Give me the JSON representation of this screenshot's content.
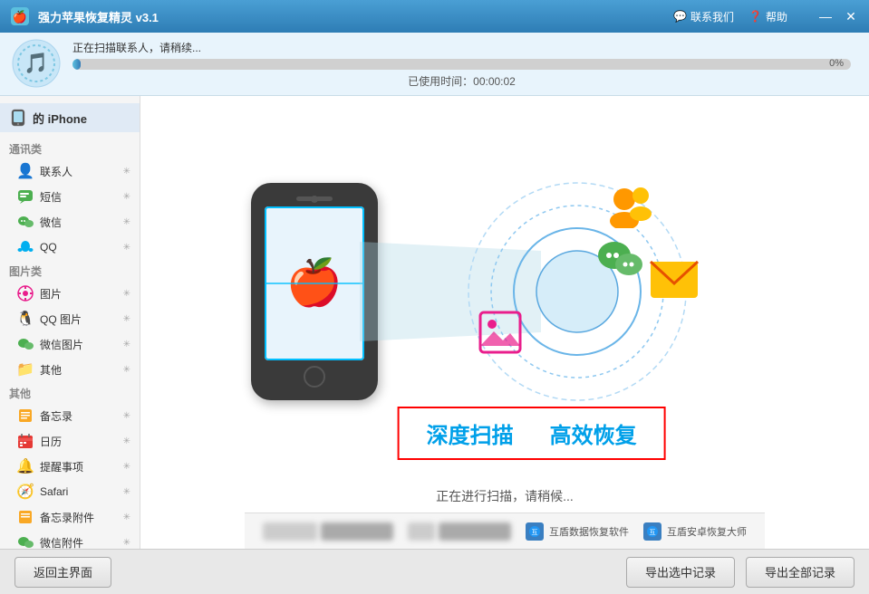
{
  "titleBar": {
    "title": "强力苹果恢复精灵 v3.1",
    "contactUs": "联系我们",
    "help": "帮助",
    "minimizeBtn": "—",
    "closeBtn": "✕"
  },
  "header": {
    "scanningLabel": "正在扫描联系人，请稍续...",
    "progressPercent": "0%",
    "timeLabel": "已使用时间：00:00:02"
  },
  "sidebar": {
    "deviceName": "的 iPhone",
    "categories": [
      {
        "label": "通讯类",
        "items": [
          {
            "name": "sidebar-item-contacts",
            "icon": "👤",
            "label": "联系人",
            "sparkle": "✳"
          },
          {
            "name": "sidebar-item-sms",
            "icon": "💬",
            "label": "短信",
            "sparkle": "✳"
          },
          {
            "name": "sidebar-item-wechat",
            "icon": "💚",
            "label": "微信",
            "sparkle": "✳"
          },
          {
            "name": "sidebar-item-qq",
            "icon": "🐧",
            "label": "QQ",
            "sparkle": "✳"
          }
        ]
      },
      {
        "label": "图片类",
        "items": [
          {
            "name": "sidebar-item-photos",
            "icon": "🌸",
            "label": "图片",
            "sparkle": "✳"
          },
          {
            "name": "sidebar-item-qq-photos",
            "icon": "🐧",
            "label": "QQ 图片",
            "sparkle": "✳"
          },
          {
            "name": "sidebar-item-wechat-photos",
            "icon": "💚",
            "label": "微信图片",
            "sparkle": "✳"
          },
          {
            "name": "sidebar-item-other",
            "icon": "📁",
            "label": "其他",
            "sparkle": "✳"
          }
        ]
      },
      {
        "label": "其他",
        "items": [
          {
            "name": "sidebar-item-notes",
            "icon": "📒",
            "label": "备忘录",
            "sparkle": "✳"
          },
          {
            "name": "sidebar-item-calendar",
            "icon": "📅",
            "label": "日历",
            "sparkle": "✳"
          },
          {
            "name": "sidebar-item-reminders",
            "icon": "🔔",
            "label": "提醒事项",
            "sparkle": "✳"
          },
          {
            "name": "sidebar-item-safari",
            "icon": "🧭",
            "label": "Safari",
            "sparkle": "✳"
          },
          {
            "name": "sidebar-item-note-attachments",
            "icon": "📒",
            "label": "备忘录附件",
            "sparkle": "✳"
          },
          {
            "name": "sidebar-item-wechat-files",
            "icon": "💚",
            "label": "微信附件",
            "sparkle": "✳"
          }
        ]
      }
    ]
  },
  "content": {
    "deepScanLabel": "深度扫描",
    "efficientRestoreLabel": "高效恢复",
    "scanningStatusLabel": "正在进行扫描，请稍候...",
    "phoneIcon": "🍎"
  },
  "adBar": {
    "item1Label": "互盾数据恢复软件",
    "item2Label": "互盾安卓恢复大师"
  },
  "footer": {
    "backBtn": "返回主界面",
    "exportSelectedBtn": "导出选中记录",
    "exportAllBtn": "导出全部记录"
  }
}
